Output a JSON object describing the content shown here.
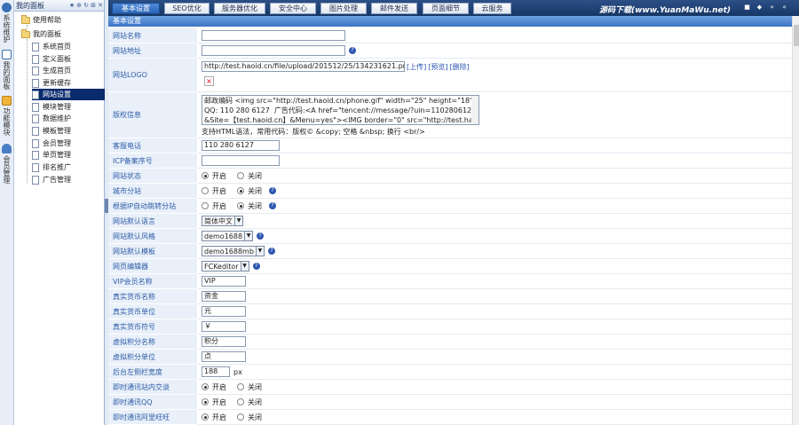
{
  "left_strip": [
    {
      "icon": "gear-icon",
      "label": "系统维护",
      "color": "#3a6fb5"
    },
    {
      "icon": "home-icon",
      "label": "我的面板",
      "color": "#3a6fb5"
    },
    {
      "icon": "module-icon",
      "label": "功能模块",
      "color": "#3a6fb5"
    },
    {
      "icon": "member-icon",
      "label": "会员管理",
      "color": "#3a6fb5"
    }
  ],
  "tree": {
    "title": "我的面板",
    "header_buttons": [
      "★",
      "⊕",
      "↻",
      "⊞",
      "✕"
    ],
    "nodes": [
      {
        "label": "使用帮助",
        "kind": "folder"
      },
      {
        "label": "我的面板",
        "kind": "folder"
      },
      {
        "label": "系统首页",
        "kind": "page"
      },
      {
        "label": "定义面板",
        "kind": "page"
      },
      {
        "label": "生成首页",
        "kind": "page"
      },
      {
        "label": "更新缓存",
        "kind": "page"
      },
      {
        "label": "网站设置",
        "kind": "page",
        "selected": true
      },
      {
        "label": "模块管理",
        "kind": "page"
      },
      {
        "label": "数据维护",
        "kind": "page"
      },
      {
        "label": "模板管理",
        "kind": "page"
      },
      {
        "label": "会员管理",
        "kind": "page"
      },
      {
        "label": "单页管理",
        "kind": "page"
      },
      {
        "label": "排名推广",
        "kind": "page"
      },
      {
        "label": "广告管理",
        "kind": "page"
      }
    ]
  },
  "tabs": [
    {
      "label": "基本设置",
      "active": true
    },
    {
      "label": "SEO优化"
    },
    {
      "label": "服务器优化"
    },
    {
      "label": "安全中心"
    },
    {
      "label": "图片处理"
    },
    {
      "label": "邮件发送"
    },
    {
      "label": "页面细节"
    },
    {
      "label": "云服务"
    }
  ],
  "brand": "源码下载(www.YuanMaWu.net)",
  "window_buttons": [
    "■",
    "◆",
    "»",
    "«"
  ],
  "section_title": "基本设置",
  "form": {
    "site_name": {
      "label": "网站名称",
      "value": ""
    },
    "site_url": {
      "label": "网站地址",
      "value": ""
    },
    "logo": {
      "label": "网站LOGO",
      "value": "http://test.haoid.cn/file/upload/201512/25/134231621.png",
      "links": [
        "[上传]",
        "[预览]",
        "[删除]"
      ],
      "x": "×"
    },
    "copyright": {
      "label": "版权信息",
      "value": "邮政编码 <img src=\"http://test.haoid.cn/phone.gif\" width=\"25\" height=\"18\">:\nQQ: 110 280 6127  广告代码:<A href=\"tencent://message/?uin=1102806127\n&Site=【test.haoid.cn】&Menu=yes\"><IMG border=\"0\" src=\"http://test.haoi",
      "help": "支持HTML语法，常用代码：版权© &copy; 空格 &nbsp; 换行 <br/>"
    },
    "phone": {
      "label": "客服电话",
      "value": "110 280 6127"
    },
    "icp": {
      "label": "ICP备案序号",
      "value": ""
    },
    "site_status": {
      "label": "网站状态",
      "on": "开启",
      "off": "关闭",
      "selected": "on"
    },
    "city_branch": {
      "label": "城市分站",
      "on": "开启",
      "off": "关闭",
      "selected": "off"
    },
    "ip_jump": {
      "label": "根据IP自动跳转分站",
      "on": "开启",
      "off": "关闭",
      "selected": "off"
    },
    "language": {
      "label": "网站默认语言",
      "value": "简体中文"
    },
    "style": {
      "label": "网站默认风格",
      "value": "demo1688"
    },
    "template": {
      "label": "网站默认模板",
      "value": "demo1688mb"
    },
    "editor": {
      "label": "网页编辑器",
      "value": "FCKeditor"
    },
    "vip_name": {
      "label": "VIP会员名称",
      "value": "VIP"
    },
    "money_name": {
      "label": "真实货币名称",
      "value": "资金"
    },
    "money_unit": {
      "label": "真实货币单位",
      "value": "元"
    },
    "money_symbol": {
      "label": "真实货币符号",
      "value": "￥"
    },
    "credit_name": {
      "label": "虚拟积分名称",
      "value": "积分"
    },
    "credit_unit": {
      "label": "虚拟积分单位",
      "value": "点"
    },
    "sidebar_width": {
      "label": "后台左侧栏宽度",
      "value": "188",
      "unit": "px"
    },
    "im_chat": {
      "label": "即时通讯站内交谈",
      "on": "开启",
      "off": "关闭",
      "selected": "on"
    },
    "im_qq": {
      "label": "即时通讯QQ",
      "on": "开启",
      "off": "关闭",
      "selected": "on"
    },
    "im_ali": {
      "label": "即时通讯阿里旺旺",
      "on": "开启",
      "off": "关闭",
      "selected": "on"
    }
  }
}
